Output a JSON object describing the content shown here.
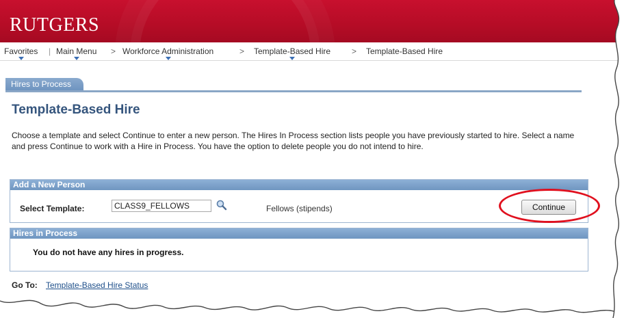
{
  "header": {
    "logo_text": "RUTGERS",
    "background": "#c8102e"
  },
  "nav": {
    "items": [
      {
        "label": "Favorites",
        "has_menu": true
      },
      {
        "label": "Main Menu",
        "has_menu": true
      },
      {
        "label": "Workforce Administration",
        "has_menu": true
      },
      {
        "label": "Template-Based Hire",
        "has_menu": true
      },
      {
        "label": "Template-Based Hire",
        "has_menu": false
      }
    ],
    "separator": ">"
  },
  "tab": {
    "label": "Hires to Process"
  },
  "page": {
    "title": "Template-Based Hire",
    "instructions": "Choose a template and select Continue to enter a new person. The Hires In Process section lists people you have previously started to hire. Select a name and press Continue to work with a Hire in Process. You have the option to delete people you do not intend to hire."
  },
  "add_new_person": {
    "header": "Add a New Person",
    "select_template_label": "Select Template:",
    "template_value": "CLASS9_FELLOWS",
    "lookup_icon": "magnifier-lookup-icon",
    "template_description": "Fellows (stipends)",
    "continue_label": "Continue"
  },
  "hires_in_process": {
    "header": "Hires in Process",
    "empty_message": "You do not have any hires in progress."
  },
  "goto": {
    "label": "Go To:",
    "link_text": "Template-Based Hire Status"
  },
  "colors": {
    "accent_blue": "#35557d",
    "group_header": "#7fa3cc",
    "link": "#1e4f8a",
    "annotation": "#e0101e"
  }
}
